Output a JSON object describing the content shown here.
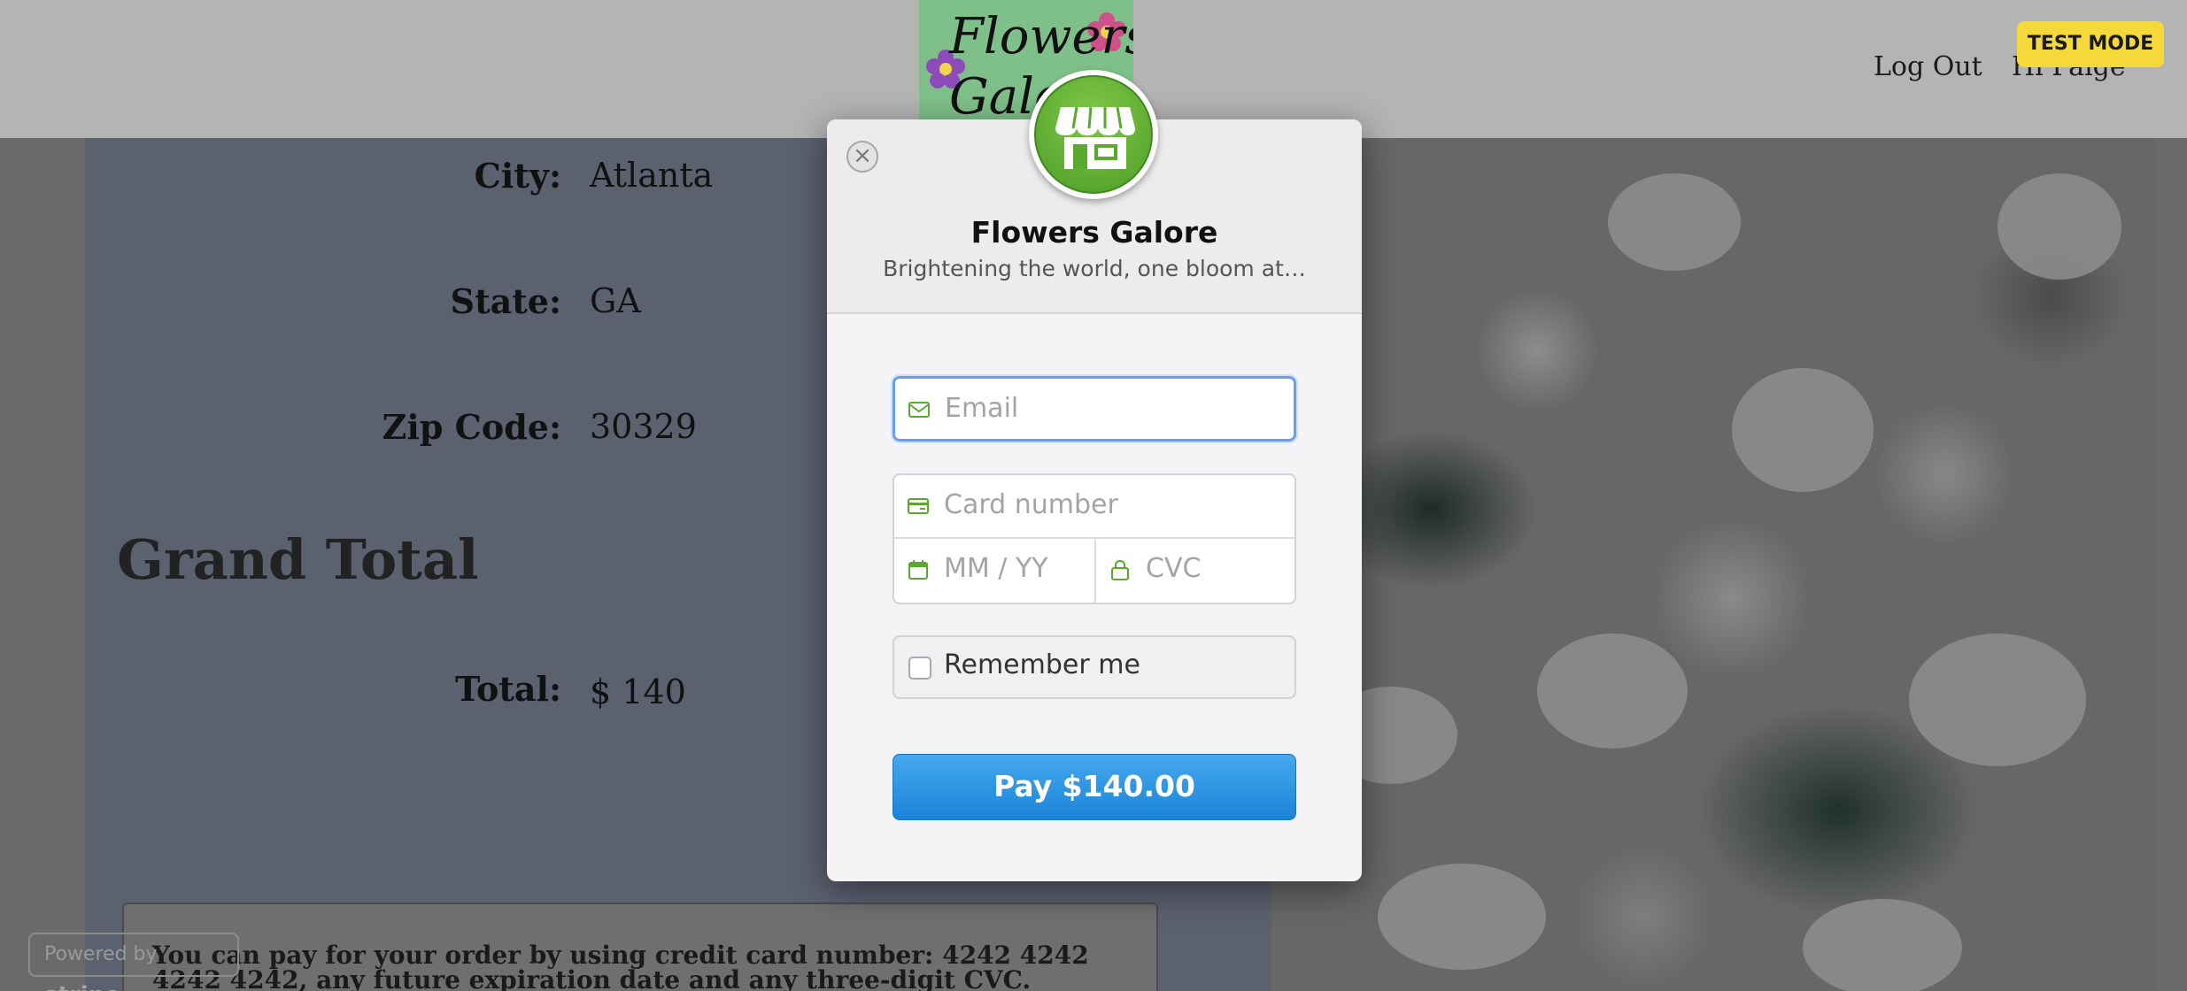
{
  "header": {
    "logo_text": "Flowers Galore",
    "nav": {
      "logout_label": "Log Out",
      "greeting": "Hi Paige"
    }
  },
  "test_mode_label": "TEST MODE",
  "order": {
    "fields": [
      {
        "label": "City:",
        "value": "Atlanta"
      },
      {
        "label": "State:",
        "value": "GA"
      },
      {
        "label": "Zip Code:",
        "value": "30329"
      }
    ],
    "grand_total_heading": "Grand Total",
    "total_label": "Total:",
    "total_value": "$ 140",
    "info_text": "You can pay for your order by using credit card number: 4242 4242 4242 4242, any future expiration date and any three-digit CVC."
  },
  "powered_by": {
    "prefix": "Powered by",
    "brand": "stripe"
  },
  "checkout": {
    "merchant_name": "Flowers Galore",
    "tagline": "Brightening the world, one bloom at…",
    "email_placeholder": "Email",
    "card_number_placeholder": "Card number",
    "expiry_placeholder": "MM / YY",
    "cvc_placeholder": "CVC",
    "remember_label": "Remember me",
    "remember_checked": false,
    "pay_label": "Pay $140.00",
    "close_icon": "close-icon",
    "colors": {
      "accent_green": "#5aa92e",
      "pay_blue": "#2b95e3",
      "focus_blue": "#6aa0ea"
    }
  }
}
